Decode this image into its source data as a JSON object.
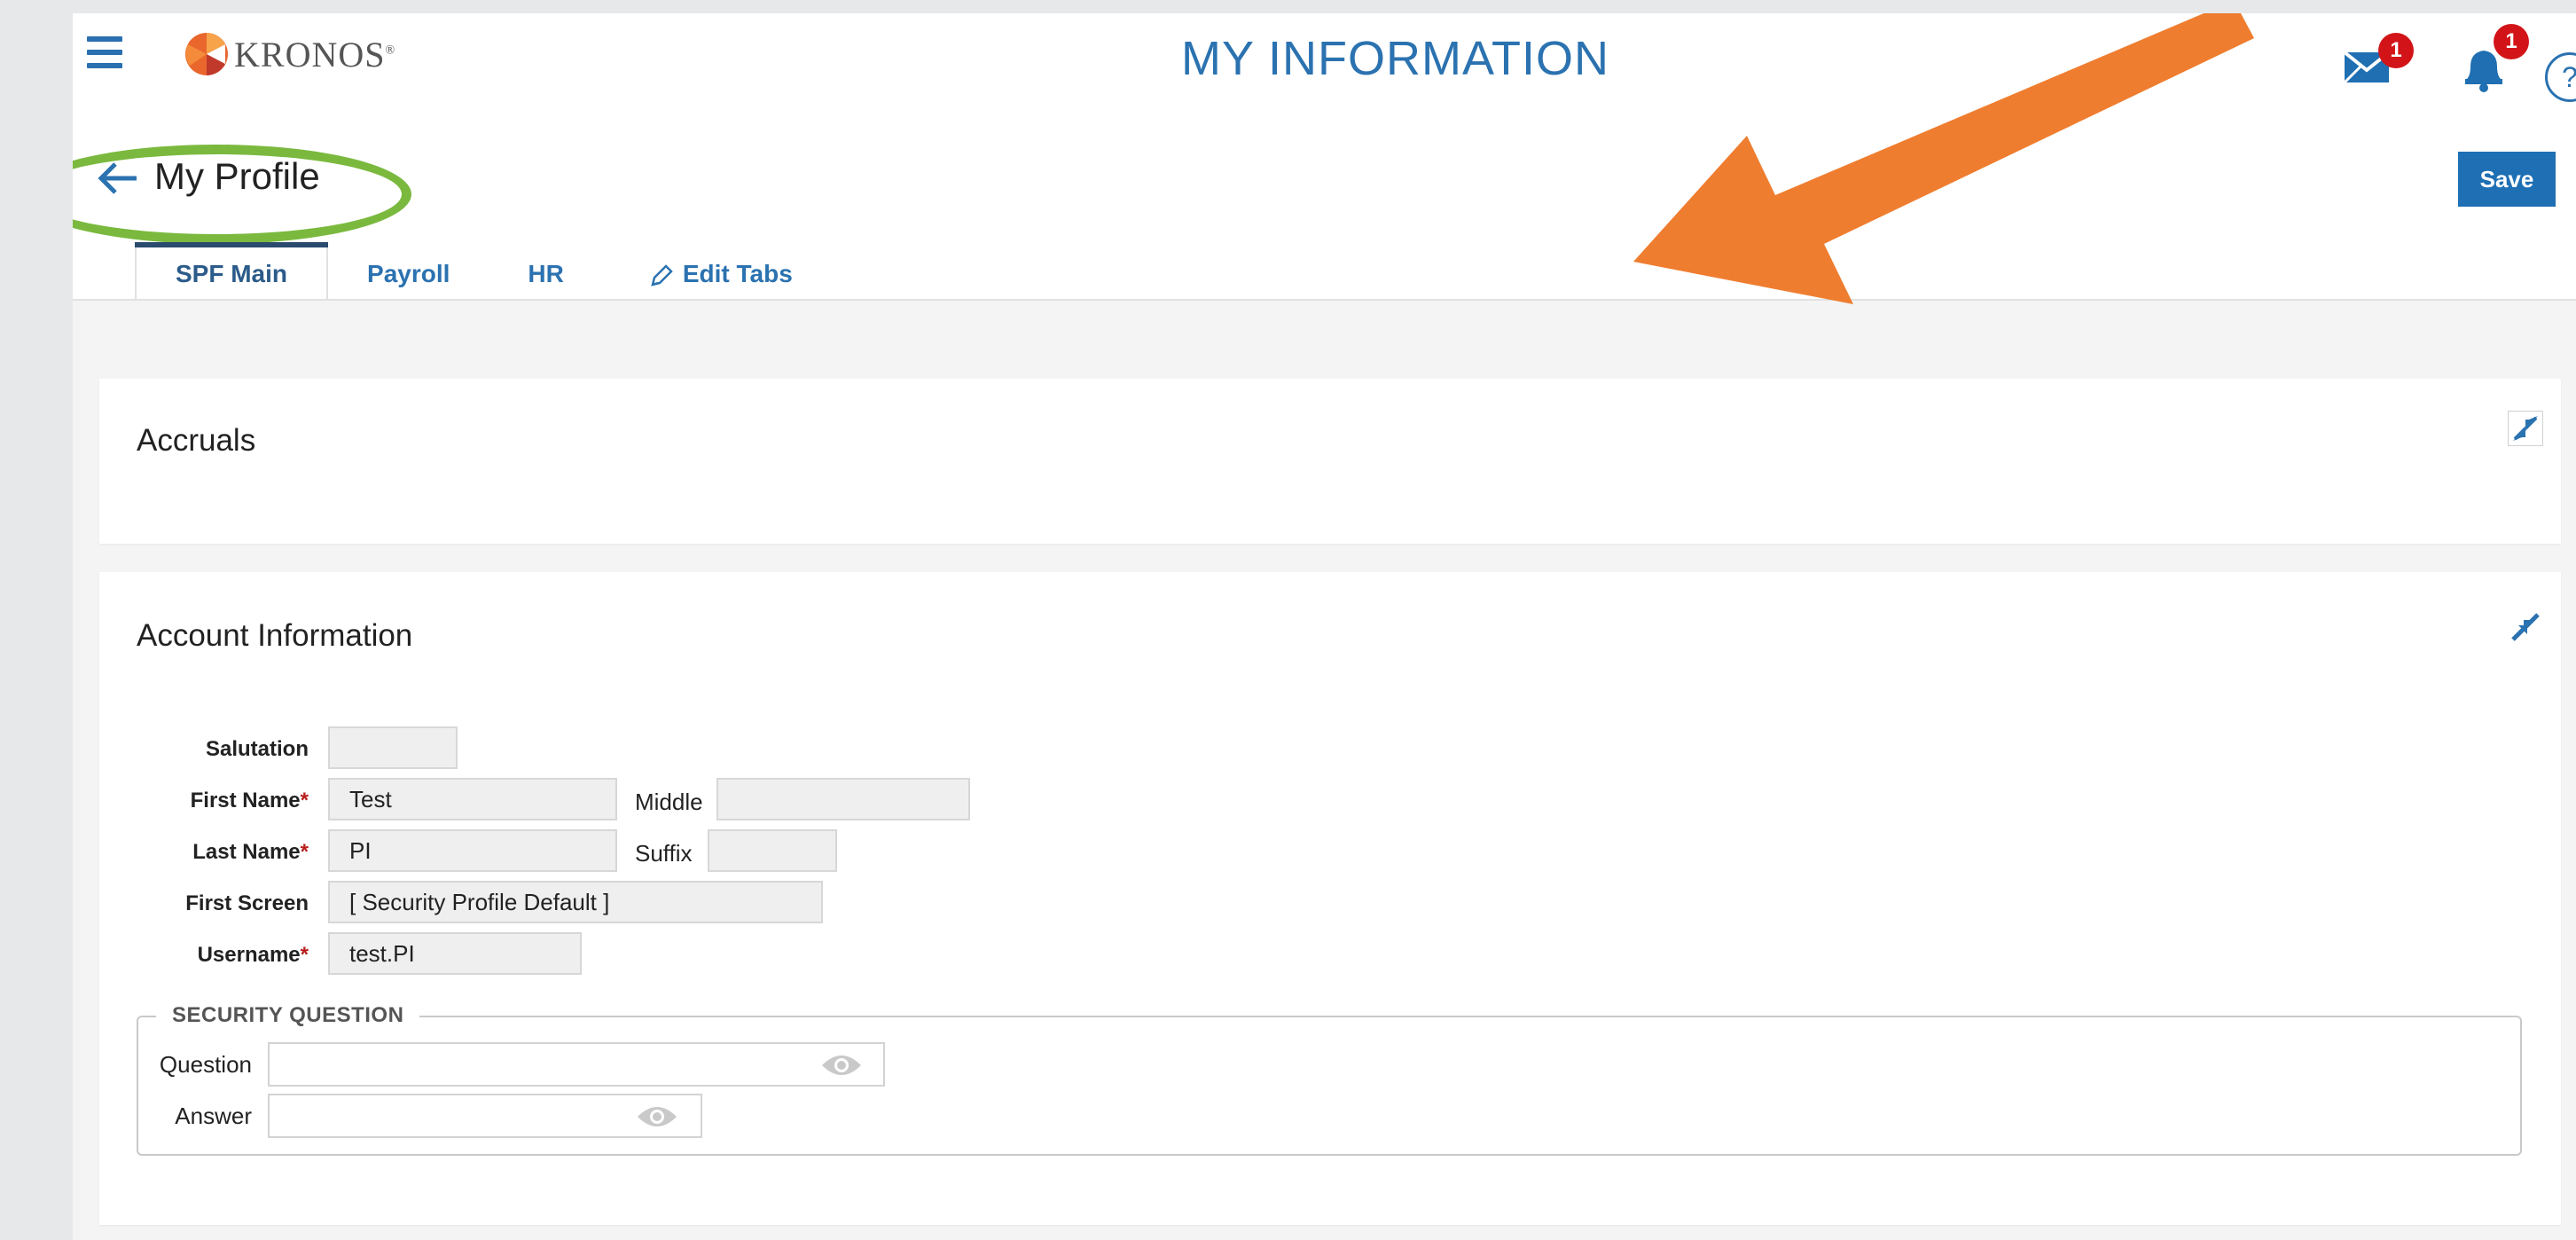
{
  "header": {
    "logo_text": "KRONOS",
    "logo_mark": "®",
    "title": "MY INFORMATION",
    "mail_badge": "1",
    "bell_badge": "1",
    "help_glyph": "?",
    "icons": [
      "menu-icon",
      "kronos-logo",
      "mail-icon",
      "bell-icon",
      "help-icon"
    ]
  },
  "profile": {
    "title": "My Profile",
    "save_label": "Save"
  },
  "tabs": [
    {
      "label": "SPF Main",
      "active": true
    },
    {
      "label": "Payroll",
      "active": false
    },
    {
      "label": "HR",
      "active": false
    },
    {
      "label": "Edit Tabs",
      "active": false
    }
  ],
  "accruals": {
    "title": "Accruals"
  },
  "account": {
    "title": "Account Information",
    "required_marker": "*",
    "salutation": {
      "label": "Salutation",
      "value": ""
    },
    "first_name": {
      "label": "First Name",
      "value": "Test"
    },
    "middle": {
      "label": "Middle",
      "value": ""
    },
    "last_name": {
      "label": "Last Name",
      "value": "PI"
    },
    "suffix": {
      "label": "Suffix",
      "value": ""
    },
    "first_screen": {
      "label": "First Screen",
      "value": "[ Security Profile Default ]"
    },
    "username": {
      "label": "Username",
      "value": "test.PI"
    },
    "security_question": {
      "legend": "SECURITY QUESTION",
      "question_label": "Question",
      "question_value": "",
      "answer_label": "Answer",
      "answer_value": ""
    }
  },
  "colors": {
    "accent_blue": "#2b72b0",
    "save_blue": "#1e6fb4",
    "badge_red": "#d21418",
    "annotation_green": "#7ab93e",
    "annotation_orange": "#ef7d2f"
  }
}
